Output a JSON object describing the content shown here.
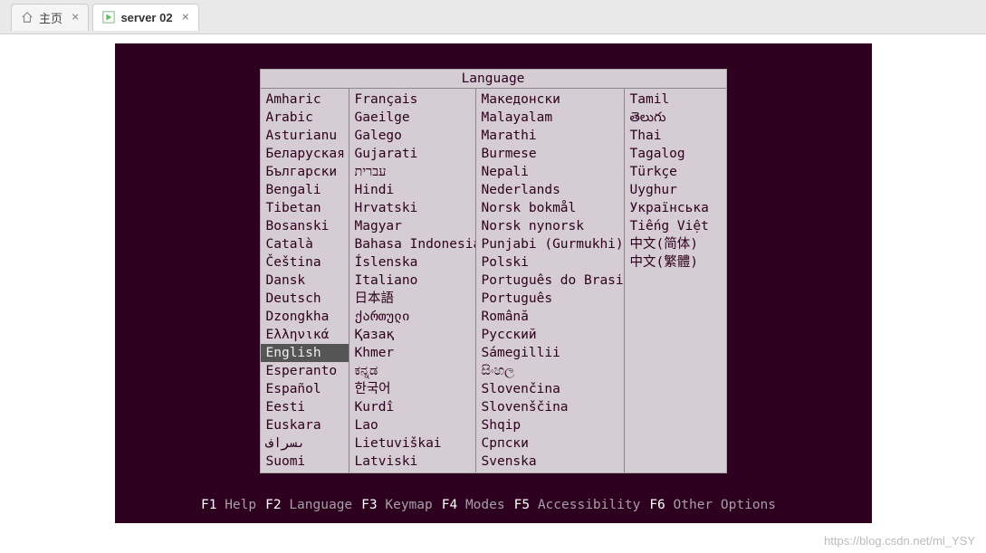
{
  "tabs": [
    {
      "label": "主页",
      "icon": "home"
    },
    {
      "label": "server 02",
      "icon": "play"
    }
  ],
  "dialog": {
    "title": "Language",
    "selected": "English",
    "columns": [
      [
        "Amharic",
        "Arabic",
        "Asturianu",
        "Беларуская",
        "Български",
        "Bengali",
        "Tibetan",
        "Bosanski",
        "Català",
        "Čeština",
        "Dansk",
        "Deutsch",
        "Dzongkha",
        "Ελληνικά",
        "English",
        "Esperanto",
        "Español",
        "Eesti",
        "Euskara",
        "ىسراف",
        "Suomi"
      ],
      [
        "Français",
        "Gaeilge",
        "Galego",
        "Gujarati",
        "עברית",
        "Hindi",
        "Hrvatski",
        "Magyar",
        "Bahasa Indonesia",
        "Íslenska",
        "Italiano",
        "日本語",
        "ქართული",
        "Қазақ",
        "Khmer",
        "ಕನ್ನಡ",
        "한국어",
        "Kurdî",
        "Lao",
        "Lietuviškai",
        "Latviski"
      ],
      [
        "Македонски",
        "Malayalam",
        "Marathi",
        "Burmese",
        "Nepali",
        "Nederlands",
        "Norsk bokmål",
        "Norsk nynorsk",
        "Punjabi (Gurmukhi)",
        "Polski",
        "Português do Brasil",
        "Português",
        "Română",
        "Русский",
        "Sámegillii",
        "සිංහල",
        "Slovenčina",
        "Slovenščina",
        "Shqip",
        "Српски",
        "Svenska"
      ],
      [
        "Tamil",
        "తెలుగు",
        "Thai",
        "Tagalog",
        "Türkçe",
        "Uyghur",
        "Українська",
        "Tiếng Việt",
        "中文(简体)",
        "中文(繁體)"
      ]
    ]
  },
  "fnkeys": [
    {
      "key": "F1",
      "label": "Help"
    },
    {
      "key": "F2",
      "label": "Language"
    },
    {
      "key": "F3",
      "label": "Keymap"
    },
    {
      "key": "F4",
      "label": "Modes"
    },
    {
      "key": "F5",
      "label": "Accessibility"
    },
    {
      "key": "F6",
      "label": "Other Options"
    }
  ],
  "watermark": "https://blog.csdn.net/ml_YSY"
}
